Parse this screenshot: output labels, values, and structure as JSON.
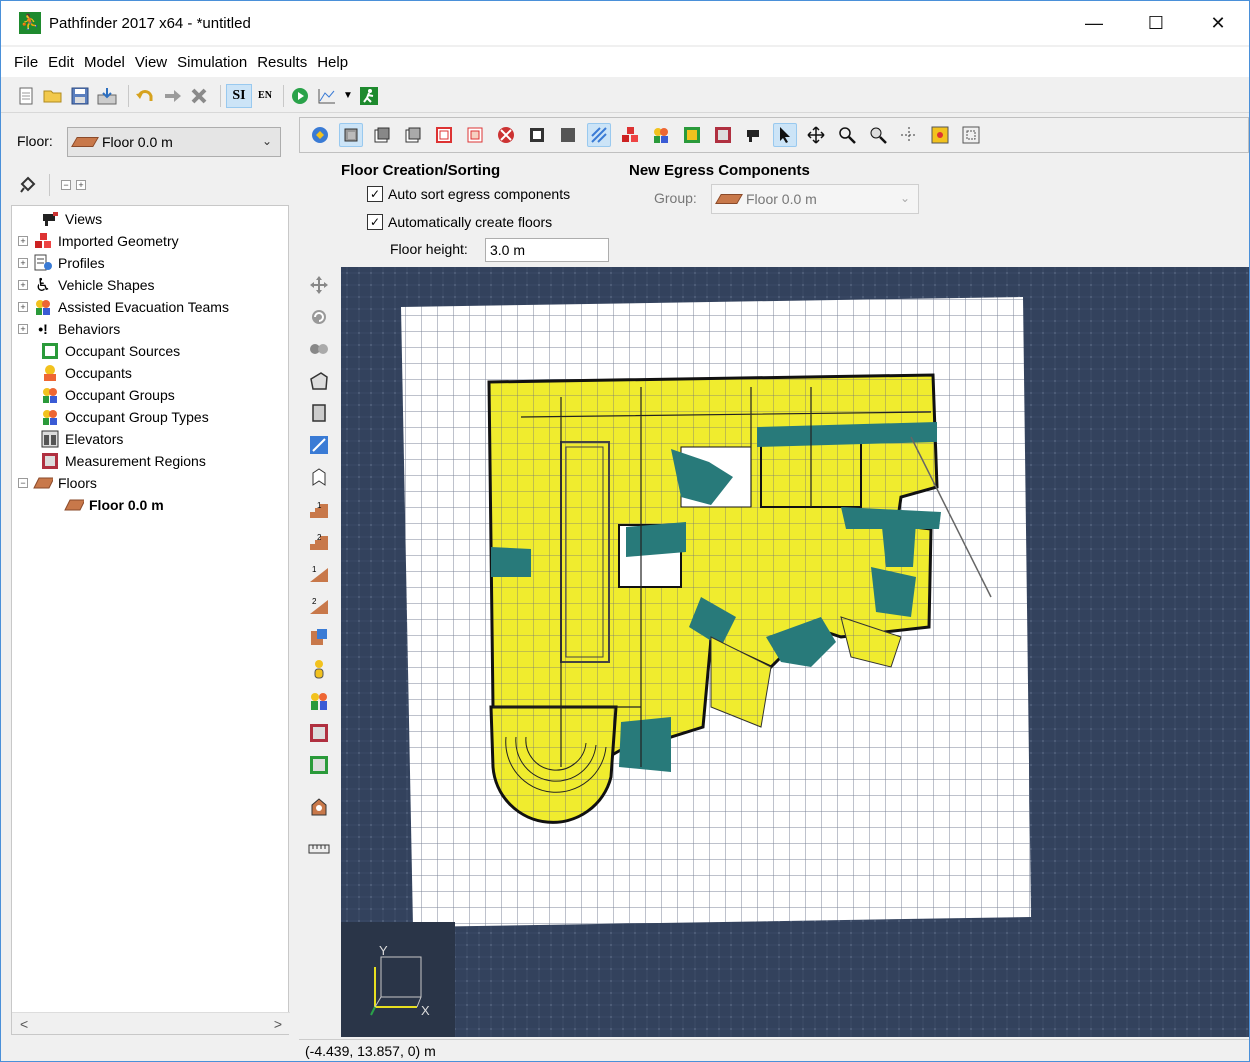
{
  "window": {
    "title": "Pathfinder 2017 x64 - *untitled",
    "minimize": "—",
    "maximize": "☐",
    "close": "✕"
  },
  "menu": [
    "File",
    "Edit",
    "Model",
    "View",
    "Simulation",
    "Results",
    "Help"
  ],
  "toolbar": {
    "si_label": "SI",
    "en_label": "EN"
  },
  "floor_selector": {
    "label": "Floor:",
    "value": "Floor 0.0 m"
  },
  "tree": {
    "items": [
      {
        "label": "Views",
        "expandable": false,
        "icon": "camera-icon"
      },
      {
        "label": "Imported Geometry",
        "expandable": true,
        "icon": "geometry-icon"
      },
      {
        "label": "Profiles",
        "expandable": true,
        "icon": "profiles-icon"
      },
      {
        "label": "Vehicle Shapes",
        "expandable": true,
        "icon": "wheelchair-icon"
      },
      {
        "label": "Assisted Evacuation Teams",
        "expandable": true,
        "icon": "team-icon"
      },
      {
        "label": "Behaviors",
        "expandable": true,
        "icon": "behaviors-icon"
      },
      {
        "label": "Occupant Sources",
        "expandable": false,
        "icon": "occupant-source-icon"
      },
      {
        "label": "Occupants",
        "expandable": false,
        "icon": "occupants-icon"
      },
      {
        "label": "Occupant Groups",
        "expandable": false,
        "icon": "occupant-groups-icon"
      },
      {
        "label": "Occupant Group Types",
        "expandable": false,
        "icon": "occupant-group-types-icon"
      },
      {
        "label": "Elevators",
        "expandable": false,
        "icon": "elevator-icon"
      },
      {
        "label": "Measurement Regions",
        "expandable": false,
        "icon": "measurement-region-icon"
      },
      {
        "label": "Floors",
        "expandable": true,
        "icon": "floors-icon"
      },
      {
        "label": "Floor 0.0 m",
        "expandable": false,
        "icon": "floor-icon"
      }
    ]
  },
  "floor_creation": {
    "title": "Floor Creation/Sorting",
    "auto_sort": "Auto sort egress components",
    "auto_create": "Automatically create floors",
    "floor_height_label": "Floor height:",
    "floor_height_value": "3.0 m"
  },
  "new_egress": {
    "title": "New Egress Components",
    "group_label": "Group:",
    "group_value": "Floor 0.0 m"
  },
  "axes": {
    "y": "Y",
    "x": "X"
  },
  "status": "(-4.439, 13.857, 0) m",
  "scroll": {
    "left": "<",
    "right": ">"
  }
}
